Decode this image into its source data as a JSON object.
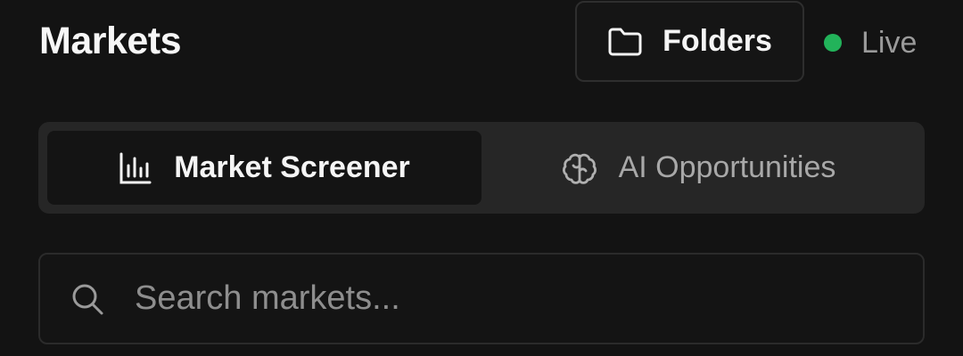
{
  "header": {
    "title": "Markets",
    "folders_button": {
      "label": "Folders",
      "icon": "folder-icon"
    },
    "status": {
      "label": "Live",
      "color": "#22b35a"
    }
  },
  "tabs": [
    {
      "label": "Market Screener",
      "icon": "bar-chart-icon",
      "active": true
    },
    {
      "label": "AI Opportunities",
      "icon": "brain-icon",
      "active": false
    }
  ],
  "search": {
    "placeholder": "Search markets...",
    "value": "",
    "icon": "search-icon"
  }
}
